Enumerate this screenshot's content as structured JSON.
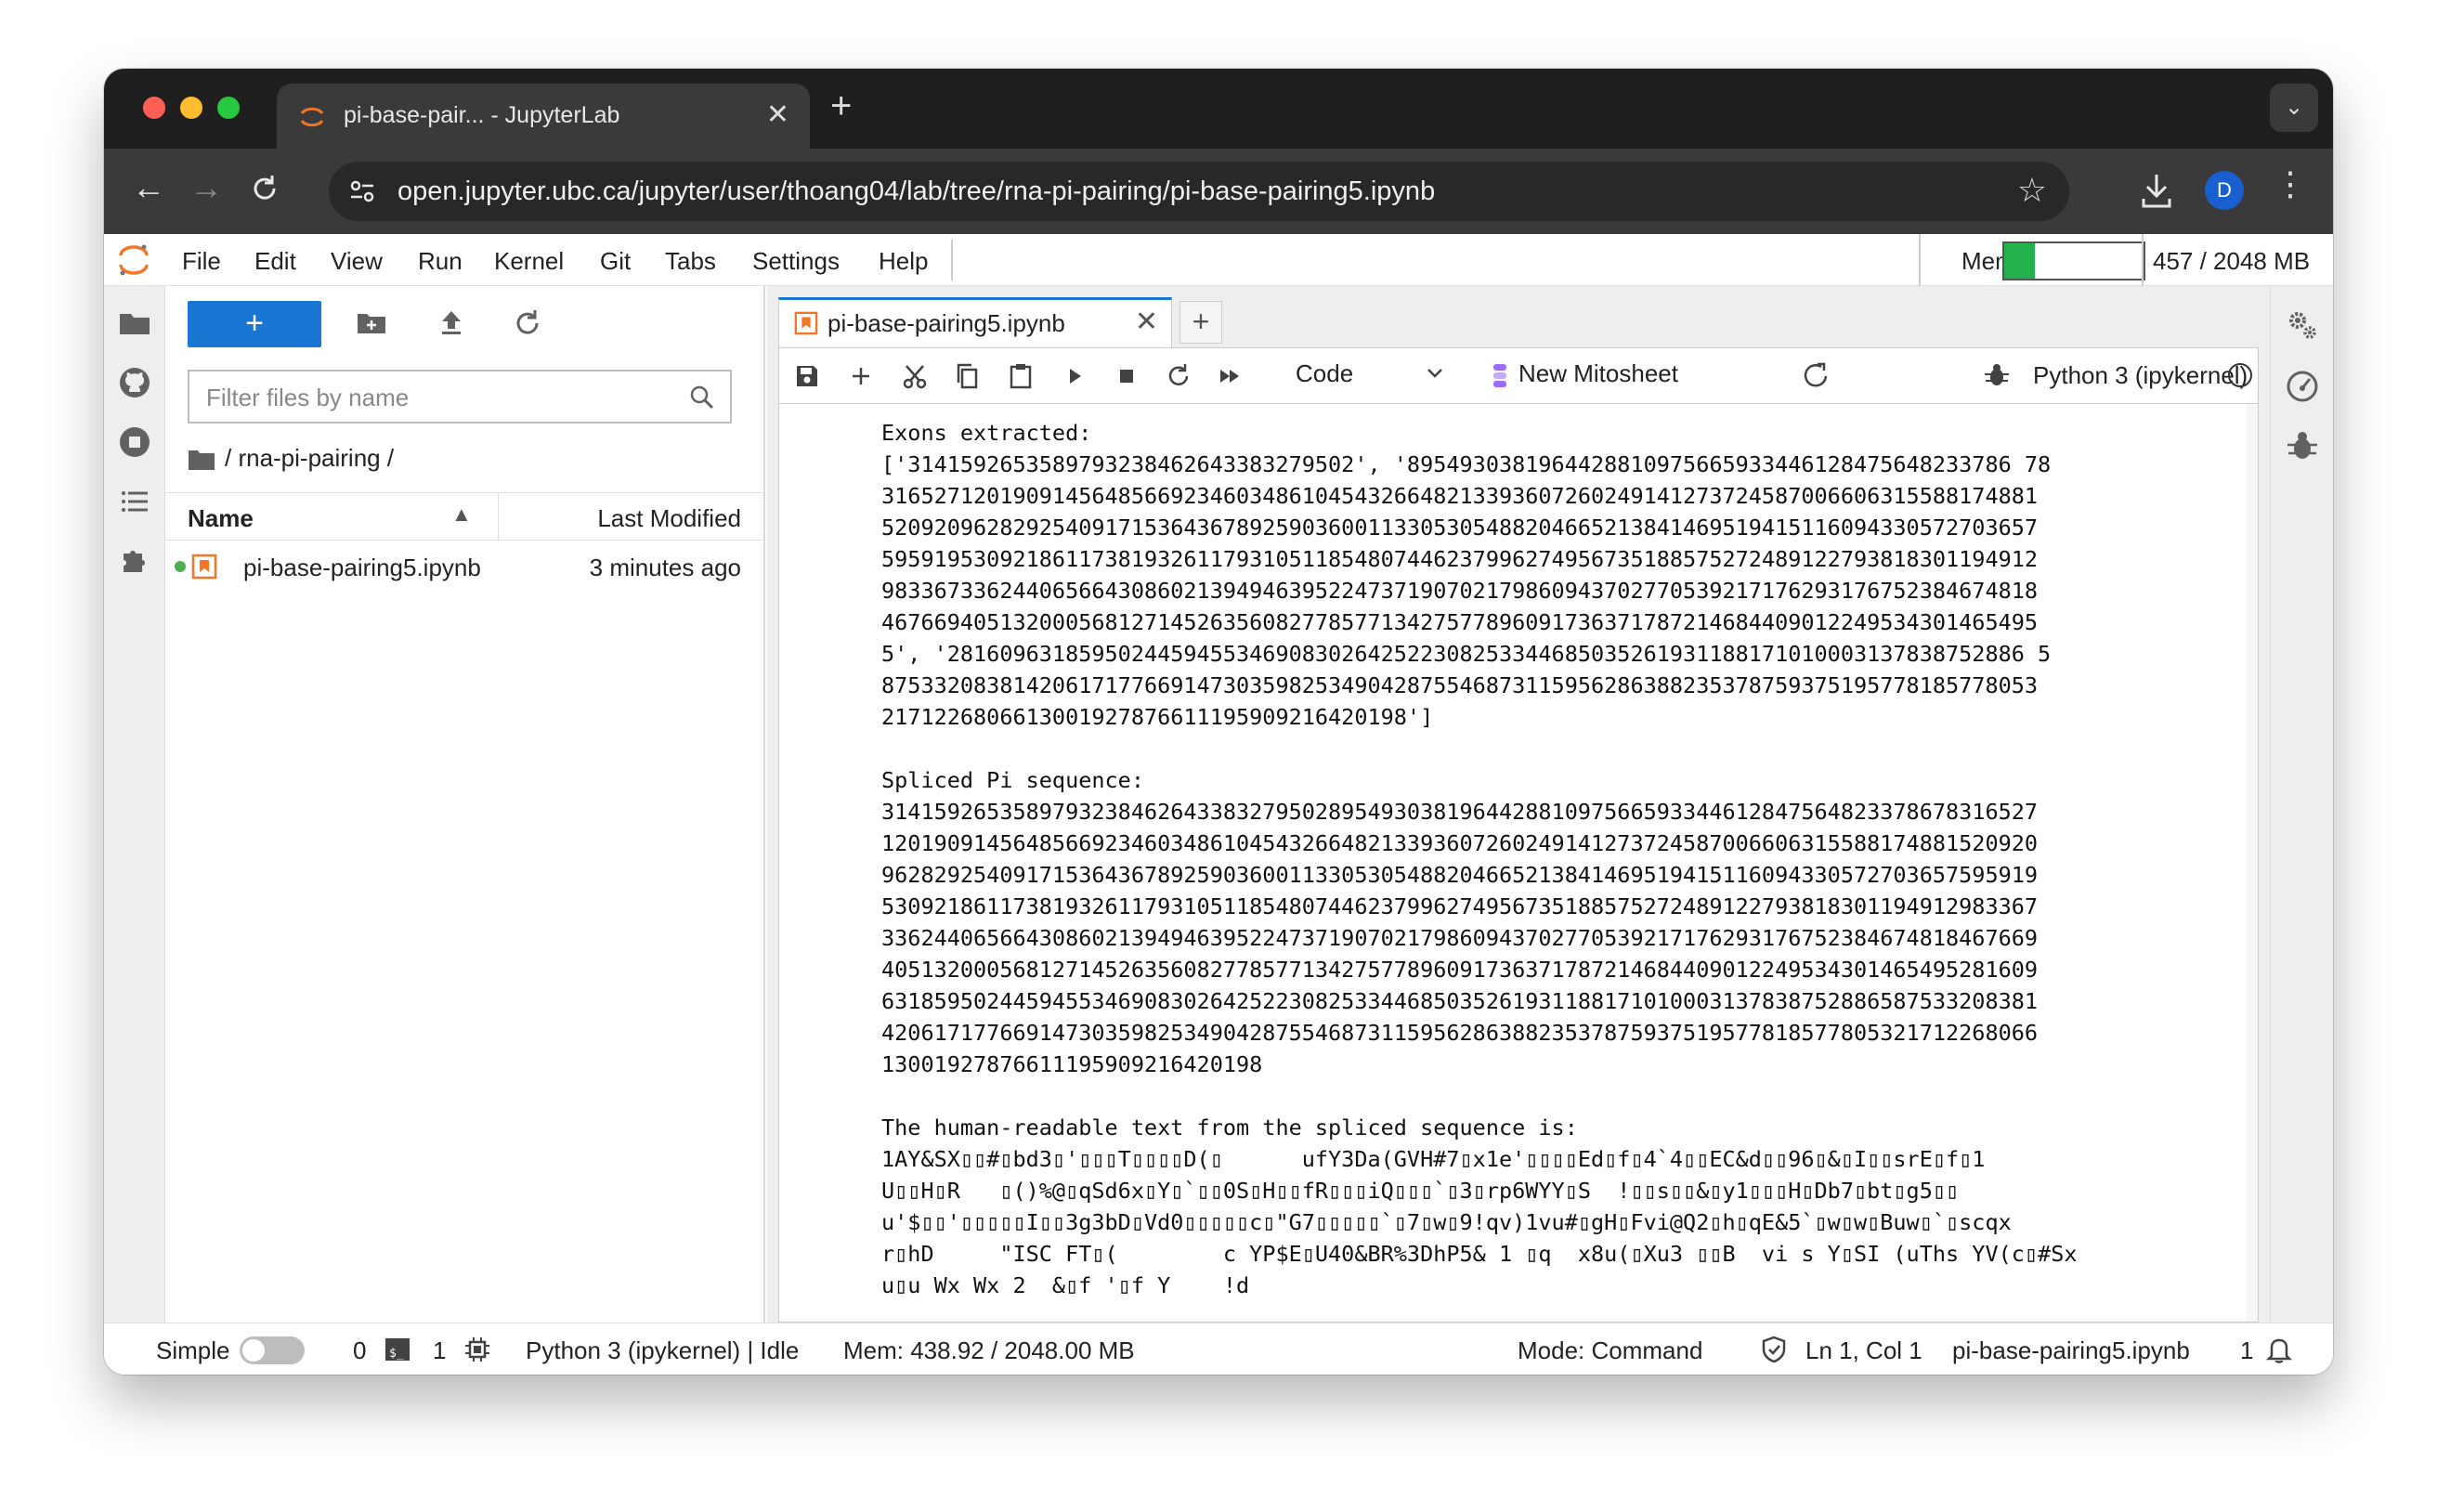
{
  "browser": {
    "tab_title": "pi-base-pair... - JupyterLab",
    "tab_close": "✕",
    "new_tab": "+",
    "url": "open.jupyter.ubc.ca/jupyter/user/thoang04/lab/tree/rna-pi-pairing/pi-base-pairing5.ipynb",
    "profile_initial": "D",
    "icons": [
      "back-arrow-icon",
      "forward-arrow-icon",
      "reload-icon",
      "site-settings-icon",
      "bookmark-star-icon",
      "download-icon",
      "kebab-menu-icon",
      "tab-list-chevron-icon"
    ]
  },
  "menubar": {
    "items": [
      "File",
      "Edit",
      "View",
      "Run",
      "Kernel",
      "Git",
      "Tabs",
      "Settings",
      "Help"
    ],
    "mem_label": "Mem:",
    "mem_value": "457 / 2048 MB",
    "mem_fraction": 0.2231
  },
  "filebrowser": {
    "new_label": "+",
    "filter_placeholder": "Filter files by name",
    "breadcrumb": "/ rna-pi-pairing /",
    "col_name": "Name",
    "col_modified": "Last Modified",
    "files": [
      {
        "name": "pi-base-pairing5.ipynb",
        "modified": "3 minutes ago",
        "running": true
      }
    ]
  },
  "notebook": {
    "tab_title": "pi-base-pairing5.ipynb",
    "tab_close": "✕",
    "new_tab": "+",
    "cell_type": "Code",
    "mitosheet_label": "New Mitosheet",
    "kernel_name": "Python 3 (ipykernel)",
    "output_lines": [
      "Exons extracted:",
      "['3141592653589793238462643383279502', '8954930381964428810975665933446128475648233786 78",
      "3165271201909145648566923460348610454326648213393607260249141273724587006606315588174881",
      "5209209628292540917153643678925903600113305305488204665213841469519415116094330572703657",
      "5959195309218611738193261179310511854807446237996274956735188575272489122793818301194912",
      "9833673362440656643086021394946395224737190702179860943702770539217176293176752384674818",
      "4676694051320005681271452635608277857713427577896091736371787214684409012249534301465495",
      "5', '2816096318595024459455346908302642522308253344685035261931188171010003137838752886 5",
      "8753320838142061717766914730359825349042875546873115956286388235378759375195778185778053",
      "2171226806613001927876611195909216420198']",
      "",
      "Spliced Pi sequence:",
      "3141592653589793238462643383279502895493038196442881097566593344612847564823378678316527",
      "1201909145648566923460348610454326648213393607260249141273724587006606315588174881520920",
      "9628292540917153643678925903600113305305488204665213841469519415116094330572703657595919",
      "5309218611738193261179310511854807446237996274956735188575272489122793818301194912983367",
      "3362440656643086021394946395224737190702179860943702770539217176293176752384674818467669",
      "4051320005681271452635608277857713427577896091736371787214684409012249534301465495281609",
      "6318595024459455346908302642522308253344685035261931188171010003137838752886587533208381",
      "4206171776691473035982534904287554687311595628638823537875937519577818577805321712268066",
      "13001927876611195909216420198",
      "",
      "The human-readable text from the spliced sequence is:",
      "1AY&SX▯▯#▯bd3▯'▯▯▯T▯▯▯▯D(▯      ufY3Da(GVH#7▯x1e'▯▯▯▯Ed▯f▯4`4▯▯EC&d▯▯96▯&▯I▯▯srE▯f▯1",
      "U▯▯H▯R   ▯()%@▯qSd6x▯Y▯`▯▯0S▯H▯▯fR▯▯▯iQ▯▯▯`▯3▯rp6WYY▯S  !▯▯s▯▯&▯y1▯▯▯H▯Db7▯bt▯g5▯▯",
      "u'$▯▯'▯▯▯▯▯I▯▯3g3bD▯Vd0▯▯▯▯▯c▯\"G7▯▯▯▯▯`▯7▯w▯9!qv)1vu#▯gH▯Fvi@Q2▯h▯qE&5`▯w▯w▯Buw▯`▯scqx",
      "r▯hD     \"ISC FT▯(        c YP$E▯U40&BR%3DhP5& 1 ▯q  x8u(▯Xu3 ▯▯B  vi s Y▯SI (uThs YV(c▯#Sx",
      "u▯u Wx Wx 2  &▯f '▯f Y    !d"
    ]
  },
  "statusbar": {
    "mode_toggle_label": "Simple",
    "terminals_count": "0",
    "kernels_count": "1",
    "kernel_status": "Python 3 (ipykernel) | Idle",
    "mem": "Mem: 438.92 / 2048.00 MB",
    "mode": "Mode: Command",
    "cursor": "Ln 1, Col 1",
    "filename": "pi-base-pairing5.ipynb",
    "notifications": "1"
  }
}
